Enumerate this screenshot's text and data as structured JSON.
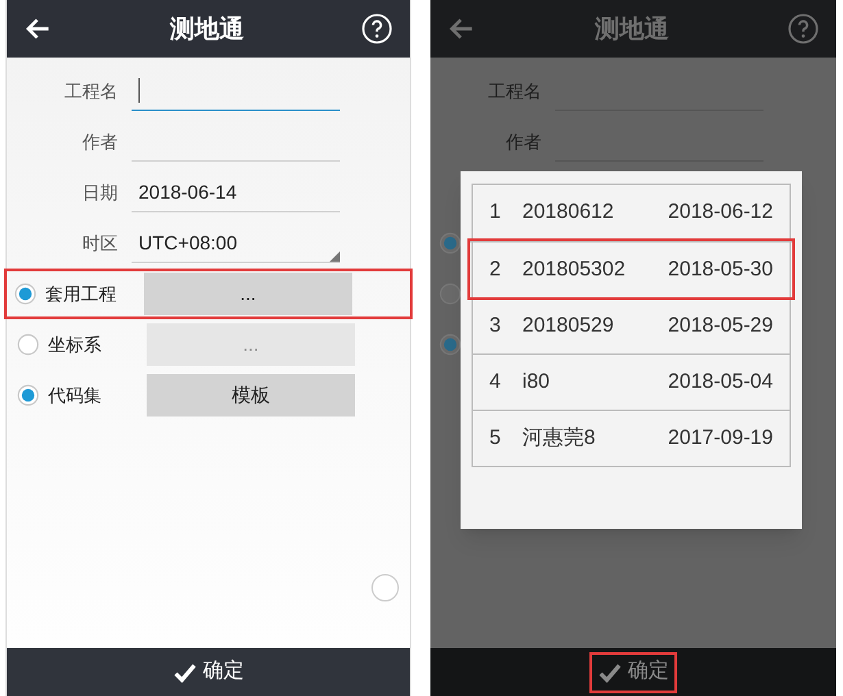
{
  "left_screen": {
    "title": "测地通",
    "fields": [
      {
        "label": "工程名",
        "focused": true,
        "kind": "text"
      },
      {
        "label": "作者",
        "focused": false,
        "kind": "text"
      },
      {
        "label": "日期",
        "value": "2018-06-14",
        "focused": false,
        "kind": "text"
      },
      {
        "label": "时区",
        "value": "UTC+08:00",
        "focused": false,
        "kind": "dropdown"
      }
    ],
    "options": [
      {
        "label": "套用工程",
        "checked": true,
        "button": "...",
        "disabled": false,
        "highlighted": true
      },
      {
        "label": "坐标系",
        "checked": false,
        "button": "...",
        "disabled": true,
        "highlighted": false
      },
      {
        "label": "代码集",
        "checked": true,
        "button": "模板",
        "disabled": false,
        "highlighted": false
      }
    ],
    "confirm": {
      "label": "确定",
      "highlighted": false
    }
  },
  "right_screen": {
    "title": "测地通",
    "fields": [
      {
        "label": "工程名"
      },
      {
        "label": "作者"
      }
    ],
    "options": [
      {
        "checked": true
      },
      {
        "checked": false
      },
      {
        "checked": true
      }
    ],
    "dialog": {
      "rows": [
        {
          "index": "1",
          "name": "20180612",
          "date": "2018-06-12",
          "highlighted": false
        },
        {
          "index": "2",
          "name": "201805302",
          "date": "2018-05-30",
          "highlighted": true
        },
        {
          "index": "3",
          "name": "20180529",
          "date": "2018-05-29",
          "highlighted": false
        },
        {
          "index": "4",
          "name": "i80",
          "date": "2018-05-04",
          "highlighted": false
        },
        {
          "index": "5",
          "name": "河惠莞8",
          "date": "2017-09-19",
          "highlighted": false
        }
      ]
    },
    "confirm": {
      "label": "确定",
      "highlighted": true
    }
  }
}
